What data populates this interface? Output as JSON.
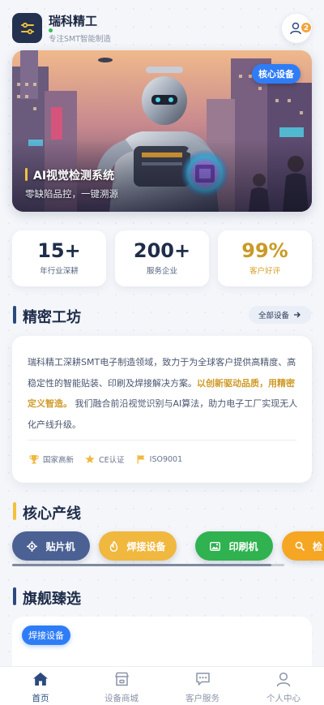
{
  "header": {
    "brand_name": "瑞科精工",
    "brand_subtitle": "专注SMT智能制造",
    "notification_count": "2"
  },
  "banner": {
    "tag": "核心设备",
    "title": "AI视觉检测系统",
    "subtitle": "零缺陷品控，一键溯源"
  },
  "stats": [
    {
      "value": "15+",
      "label": "年行业深耕"
    },
    {
      "value": "200+",
      "label": "服务企业"
    },
    {
      "value": "99%",
      "label": "客户好评"
    }
  ],
  "workshop": {
    "title": "精密工坊",
    "all_label": "全部设备",
    "intro_part1": "瑞科精工深耕SMT电子制造领域，致力于为全球客户提供高精度、高稳定性的智能贴装、印刷及焊接解决方案。",
    "intro_highlight": "以创新驱动品质，用精密定义智造。",
    "intro_part2": "我们融合前沿视觉识别与AI算法，助力电子工厂实现无人化产线升级。",
    "badges": [
      "国家高新",
      "CE认证",
      "ISO9001"
    ]
  },
  "product_lines": {
    "title": "核心产线",
    "items": [
      {
        "label": "贴片机",
        "color": "#4b6193"
      },
      {
        "label": "焊接设备",
        "color": "#f0b83e"
      },
      {
        "label": "印刷机",
        "color": "#2fb24f"
      },
      {
        "label": "检",
        "color": "#f5a623"
      }
    ]
  },
  "flagship": {
    "title": "旗舰臻选",
    "tag": "焊接设备"
  },
  "tabbar": {
    "items": [
      {
        "label": "首页",
        "active": true
      },
      {
        "label": "设备商城"
      },
      {
        "label": "客户服务"
      },
      {
        "label": "个人中心"
      }
    ]
  },
  "colors": {
    "primary": "#2b4a7e",
    "accent_blue": "#2f7df6",
    "gold": "#d9a02d"
  }
}
